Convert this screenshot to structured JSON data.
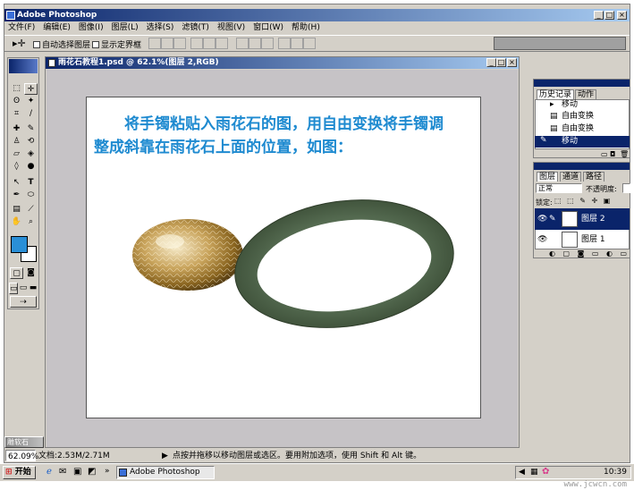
{
  "app": {
    "title": "Adobe Photoshop"
  },
  "menu": [
    "文件(F)",
    "编辑(E)",
    "图像(I)",
    "图层(L)",
    "选择(S)",
    "滤镜(T)",
    "视图(V)",
    "窗口(W)",
    "帮助(H)"
  ],
  "options": {
    "auto_select": "自动选择图层",
    "show_bounds": "显示定界框"
  },
  "document": {
    "title": "雨花石教程1.psd @ 62.1%(图层 2,RGB)",
    "text_line1": "将手镯粘贴入雨花石的图，用自由变换将手镯调",
    "text_line2": "整成斜靠在雨花石上面的位置，如图："
  },
  "history": {
    "tabs": [
      "历史记录",
      "动作"
    ],
    "items": [
      "移动",
      "自由变换",
      "自由变换",
      "移动"
    ]
  },
  "layers": {
    "tabs": [
      "图层",
      "通道",
      "路径"
    ],
    "mode": "正常",
    "opacity_label": "不透明度:",
    "lock_label": "锁定:",
    "items": [
      "图层 2",
      "图层 1"
    ]
  },
  "status": {
    "zoom": "62.09%",
    "doc_size": "文档:2.53M/2.71M",
    "hint": "点按并拖移以移动图层或选区。要用附加选项，使用 Shift 和 Alt 键。"
  },
  "minimized_doc": "雕软石",
  "taskbar": {
    "start": "开始",
    "task": "Adobe Photoshop",
    "clock": "10:39"
  },
  "watermark": "www.jcwcn.com",
  "colors": {
    "title_blue": "#0a246a",
    "text_blue": "#1e8ad0",
    "fg_swatch": "#2a8fd6"
  }
}
